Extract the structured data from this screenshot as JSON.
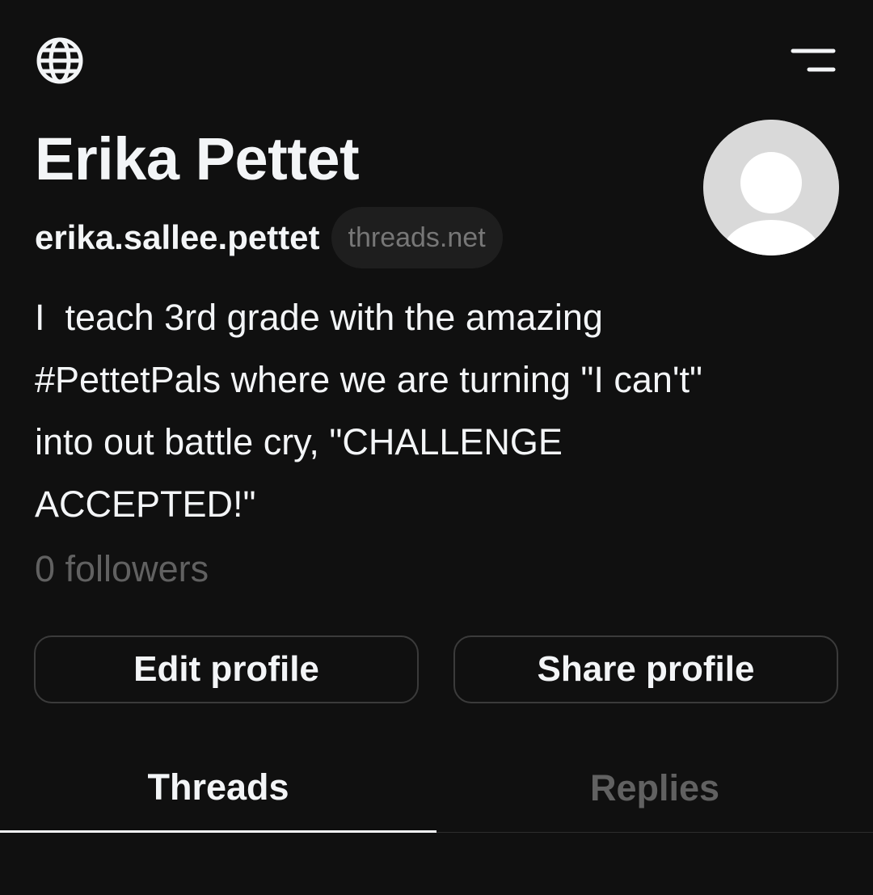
{
  "header": {
    "left_icon": "globe-icon",
    "right_icon": "menu-icon"
  },
  "profile": {
    "display_name": "Erika Pettet",
    "username": "erika.sallee.pettet",
    "domain_badge": "threads.net",
    "avatar": "default-avatar-icon",
    "bio": "I  teach 3rd grade with the amazing\n#PettetPals where we are turning \"I can't\"\ninto out battle cry, \"CHALLENGE\nACCEPTED!\"",
    "followers": "0 followers"
  },
  "actions": {
    "edit_label": "Edit profile",
    "share_label": "Share profile"
  },
  "tabs": [
    {
      "label": "Threads",
      "active": true
    },
    {
      "label": "Replies",
      "active": false
    }
  ],
  "colors": {
    "background": "#101010",
    "text_primary": "#f3f5f7",
    "text_secondary": "#616161",
    "pill_background": "#1e1e1e",
    "button_border": "#3b3b3b"
  }
}
